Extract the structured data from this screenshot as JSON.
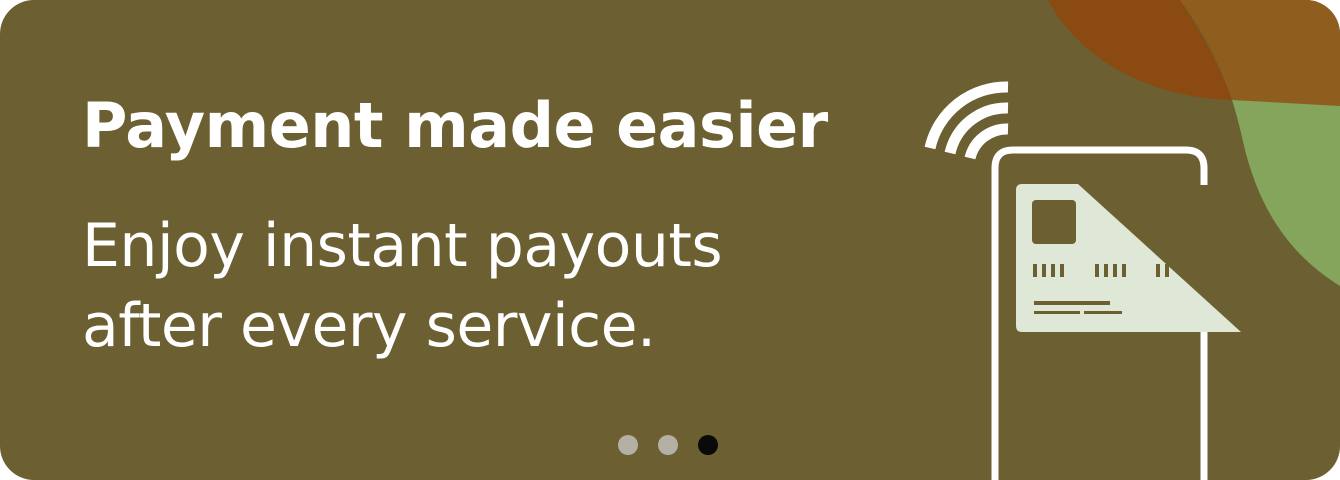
{
  "banner": {
    "headline": "Payment made easier",
    "subline_line1": "Enjoy instant payouts",
    "subline_line2": "after every service."
  },
  "carousel": {
    "total_slides": 3,
    "active_slide": 3
  },
  "colors": {
    "background": "#6c5f31",
    "blob_brown": "#8a4a12",
    "blob_orange": "#8f5e1f",
    "blob_green": "#86a55c",
    "card": "#dfe7d6",
    "card_detail": "#6c5f31",
    "text": "#ffffff",
    "dot_inactive": "#b4b0a6",
    "dot_active": "#0a0a0a"
  },
  "icons": [
    "contactless-icon",
    "phone-icon",
    "credit-card-icon"
  ]
}
